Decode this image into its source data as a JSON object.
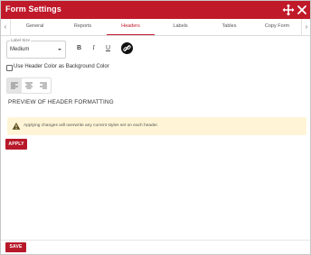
{
  "window": {
    "title": "Form Settings",
    "accent_color": "#c0192a",
    "move_icon": "move-arrows-icon",
    "close_icon": "close-icon"
  },
  "tabs": {
    "items": [
      {
        "label": "General"
      },
      {
        "label": "Reports"
      },
      {
        "label": "Headers",
        "active": true
      },
      {
        "label": "Labels"
      },
      {
        "label": "Tables"
      },
      {
        "label": "Copy Form"
      }
    ],
    "left_arrow": "‹",
    "right_arrow": "›"
  },
  "header_settings": {
    "label_size": {
      "legend": "Label Size",
      "value": "Medium"
    },
    "format_buttons": {
      "bold": "B",
      "italic": "I",
      "underline": "U",
      "color_icon": "link-color-icon"
    },
    "use_header_color_checkbox": {
      "label": "Use Header Color as Background Color",
      "checked": false
    },
    "alignment": {
      "options": [
        "align-left",
        "align-center",
        "align-right"
      ],
      "selected": "align-left"
    },
    "preview_text": "PREVIEW OF HEADER FORMATTING",
    "warning": {
      "text": "Applying changes will overwrite any current styles set on each header.",
      "icon": "warning-icon",
      "background": "#fff5d6"
    },
    "apply_label": "APPLY"
  },
  "footer": {
    "save_label": "SAVE"
  }
}
